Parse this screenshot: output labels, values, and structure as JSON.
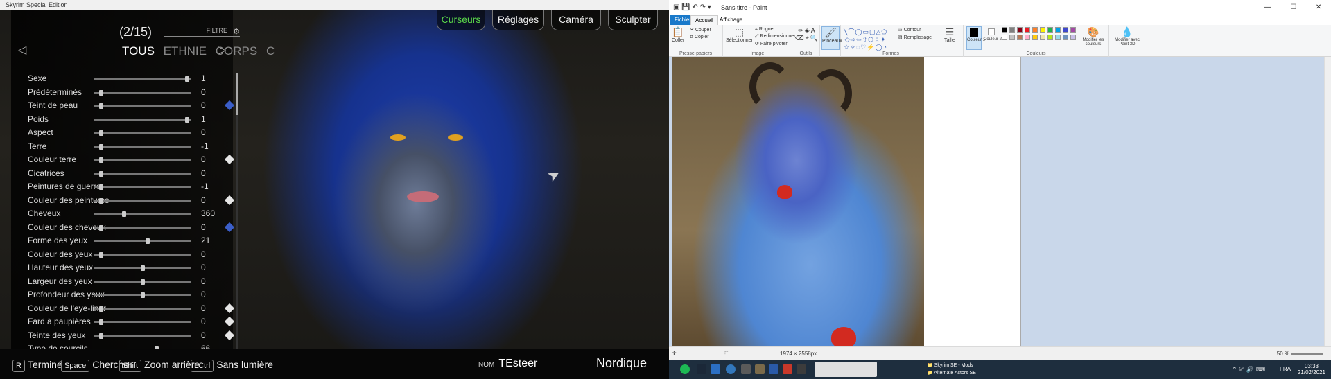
{
  "skyrim": {
    "window_title": "Skyrim Special Edition",
    "counter": "(2/15)",
    "filter_label": "FILTRE",
    "categories": [
      {
        "label": "TOUS",
        "active": true
      },
      {
        "label": "ETHNIE",
        "active": false
      },
      {
        "label": "CORPS",
        "active": false
      },
      {
        "label": "C",
        "active": false
      }
    ],
    "top_tabs": [
      {
        "label": "Curseurs",
        "active": true
      },
      {
        "label": "Réglages",
        "active": false
      },
      {
        "label": "Caméra",
        "active": false
      },
      {
        "label": "Sculpter",
        "active": false
      }
    ],
    "sliders": [
      {
        "label": "Sexe",
        "value": "1",
        "level": 0.98,
        "diamond": ""
      },
      {
        "label": "Prédéterminés",
        "value": "0",
        "level": 0.05,
        "diamond": ""
      },
      {
        "label": "Teint de peau",
        "value": "0",
        "level": 0.05,
        "diamond": "blue"
      },
      {
        "label": "Poids",
        "value": "1",
        "level": 0.98,
        "diamond": ""
      },
      {
        "label": "Aspect",
        "value": "0",
        "level": 0.05,
        "diamond": ""
      },
      {
        "label": "Terre",
        "value": "-1",
        "level": 0.05,
        "diamond": ""
      },
      {
        "label": "Couleur terre",
        "value": "0",
        "level": 0.05,
        "diamond": "white"
      },
      {
        "label": "Cicatrices",
        "value": "0",
        "level": 0.05,
        "diamond": ""
      },
      {
        "label": "Peintures de guerre",
        "value": "-1",
        "level": 0.05,
        "diamond": ""
      },
      {
        "label": "Couleur des peintures",
        "value": "0",
        "level": 0.05,
        "diamond": "white"
      },
      {
        "label": "Cheveux",
        "value": "360",
        "level": 0.3,
        "diamond": ""
      },
      {
        "label": "Couleur des cheveux",
        "value": "0",
        "level": 0.05,
        "diamond": "blue"
      },
      {
        "label": "Forme des yeux",
        "value": "21",
        "level": 0.55,
        "diamond": ""
      },
      {
        "label": "Couleur des yeux",
        "value": "0",
        "level": 0.05,
        "diamond": ""
      },
      {
        "label": "Hauteur des yeux",
        "value": "0",
        "level": 0.5,
        "diamond": ""
      },
      {
        "label": "Largeur des yeux",
        "value": "0",
        "level": 0.5,
        "diamond": ""
      },
      {
        "label": "Profondeur des yeux",
        "value": "0",
        "level": 0.5,
        "diamond": ""
      },
      {
        "label": "Couleur de l'eye-liner",
        "value": "0",
        "level": 0.05,
        "diamond": "white"
      },
      {
        "label": "Fard à paupières",
        "value": "0",
        "level": 0.05,
        "diamond": "white"
      },
      {
        "label": "Teinte des yeux",
        "value": "0",
        "level": 0.05,
        "diamond": "white"
      },
      {
        "label": "Type de sourcils",
        "value": "66",
        "level": 0.65,
        "diamond": ""
      }
    ],
    "hints": [
      {
        "key": "R",
        "label": "Terminé"
      },
      {
        "key": "Space",
        "label": "Chercher"
      },
      {
        "key": "Shift",
        "label": "Zoom arrière"
      },
      {
        "key": "LCtrl",
        "label": "Sans lumière"
      }
    ],
    "name_label": "NOM",
    "name_value": "TEsteer",
    "race_value": "Nordique"
  },
  "paint": {
    "window_title": "Sans titre - Paint",
    "window_controls": [
      "—",
      "☐",
      "✕"
    ],
    "tabs": {
      "file": "Fichier",
      "home": "Accueil",
      "view": "Affichage"
    },
    "clipboard": {
      "paste": "Coller",
      "cut": "Couper",
      "copy": "Copier",
      "group": "Presse-papiers"
    },
    "image": {
      "select": "Sélectionner",
      "crop": "Rogner",
      "resize": "Redimensionner",
      "rotate": "Faire pivoter",
      "group": "Image"
    },
    "tools_group": "Outils",
    "brushes": "Pinceaux",
    "shapes": {
      "outline": "Contour",
      "fill": "Remplissage",
      "group": "Formes"
    },
    "size": "Taille",
    "color1": "Couleur 1",
    "color2": "Couleur 2",
    "colors_group": "Couleurs",
    "edit_colors": "Modifier les couleurs",
    "edit_paint3d": "Modifier avec Paint 3D",
    "palette": [
      "#000000",
      "#7f7f7f",
      "#880015",
      "#ed1c24",
      "#ff7f27",
      "#fff200",
      "#22b14c",
      "#00a2e8",
      "#3f48cc",
      "#a349a4",
      "#ffffff",
      "#c3c3c3",
      "#b97a57",
      "#ffaec9",
      "#ffc90e",
      "#efe4b0",
      "#b5e61d",
      "#99d9ea",
      "#7092be",
      "#c8bfe7"
    ],
    "image_size": "1974 × 2558px",
    "zoom": "50 %"
  },
  "taskbar": {
    "tasks": [
      "Skyrim SE - Mods",
      "Alternate Actors SE"
    ],
    "lang": "FRA",
    "time": "03:33",
    "date": "21/02/2021"
  }
}
